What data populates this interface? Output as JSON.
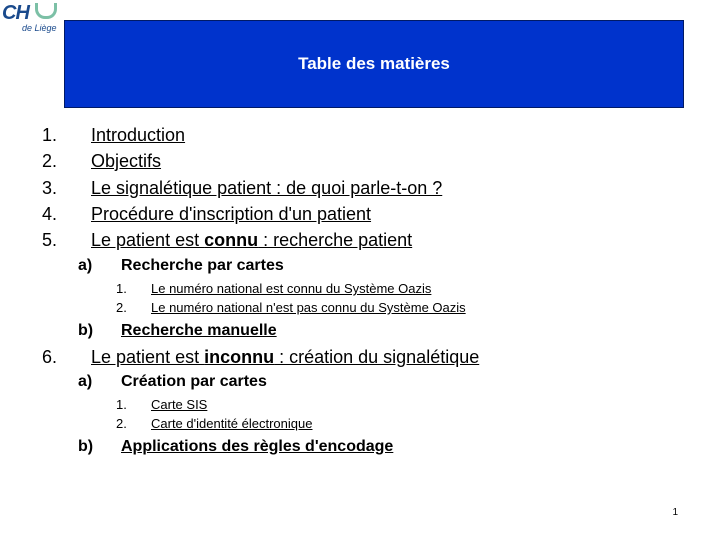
{
  "logo": {
    "main": "CH",
    "sub": "de Liège",
    "colors": {
      "primary": "#1a4a8c",
      "accent": "#7cc0a6"
    }
  },
  "banner": {
    "title": "Table des matières",
    "color": "#0033cc"
  },
  "toc": [
    {
      "num": "1.",
      "text": "Introduction"
    },
    {
      "num": "2.",
      "text": "Objectifs"
    },
    {
      "num": "3.",
      "text": "Le signalétique patient : de quoi parle-t-on ?"
    },
    {
      "num": "4.",
      "text": "Procédure d'inscription d'un patient"
    },
    {
      "num": "5.",
      "text_before": "Le patient est ",
      "text_bold": "connu",
      "text_after": " : recherche patient",
      "sub": [
        {
          "num": "a)",
          "text": "Recherche par cartes",
          "sub": [
            {
              "num": "1.",
              "text": "Le numéro national est connu du Système Oazis"
            },
            {
              "num": "2.",
              "text": "Le numéro national n'est pas connu du Système Oazis"
            }
          ]
        },
        {
          "num": "b)",
          "text": "Recherche manuelle"
        }
      ]
    },
    {
      "num": "6.",
      "text_before": "Le patient est ",
      "text_bold": "inconnu",
      "text_after": " : création du signalétique",
      "sub": [
        {
          "num": "a)",
          "text": "Création par cartes",
          "sub": [
            {
              "num": "1.",
              "text": "Carte SIS"
            },
            {
              "num": "2.",
              "text": "Carte d'identité électronique"
            }
          ]
        },
        {
          "num": "b)",
          "text": "Applications des règles d'encodage"
        }
      ]
    }
  ],
  "page_number": "1"
}
